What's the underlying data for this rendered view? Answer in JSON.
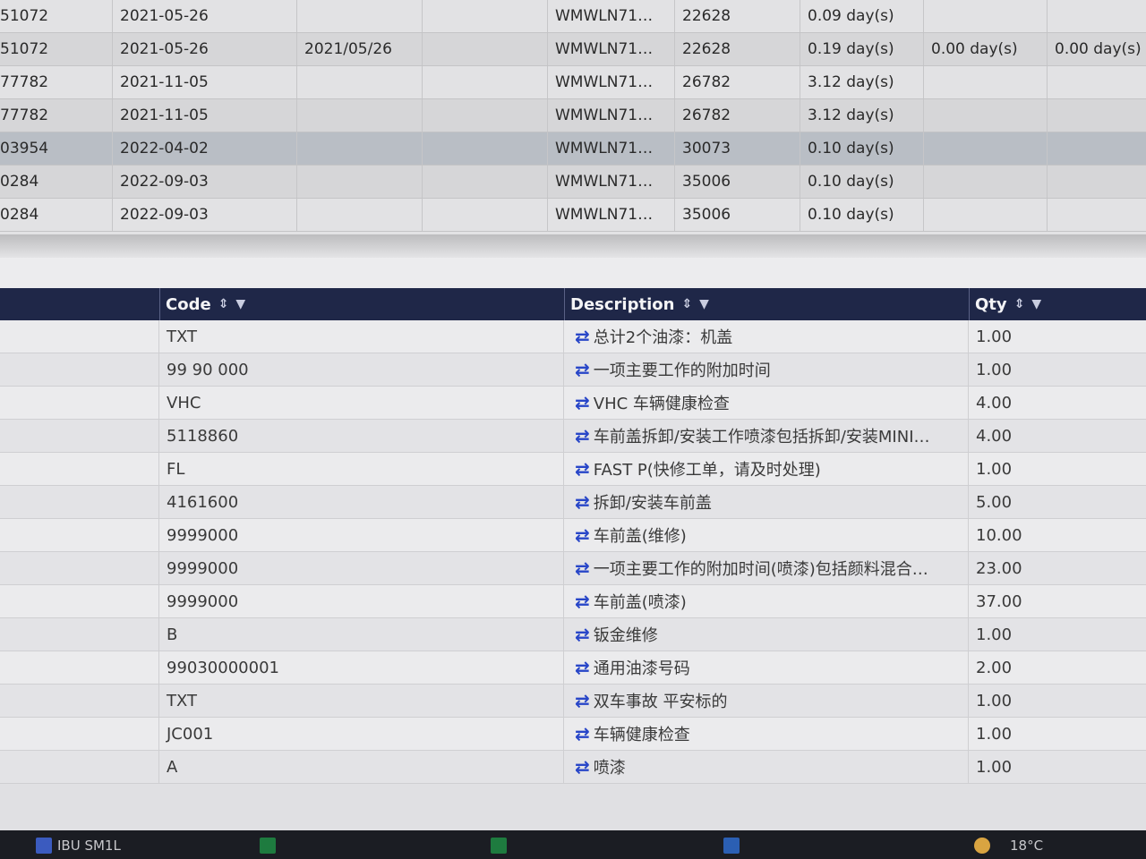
{
  "history": {
    "rows": [
      {
        "id": "51072",
        "date": "2021-05-26",
        "date2": "",
        "vin": "WMWLN71…",
        "km": "22628",
        "d1": "0.09 day(s)",
        "d2": "",
        "d3": ""
      },
      {
        "id": "51072",
        "date": "2021-05-26",
        "date2": "2021/05/26",
        "vin": "WMWLN71…",
        "km": "22628",
        "d1": "0.19 day(s)",
        "d2": "0.00 day(s)",
        "d3": "0.00 day(s)"
      },
      {
        "id": "77782",
        "date": "2021-11-05",
        "date2": "",
        "vin": "WMWLN71…",
        "km": "26782",
        "d1": "3.12 day(s)",
        "d2": "",
        "d3": ""
      },
      {
        "id": "77782",
        "date": "2021-11-05",
        "date2": "",
        "vin": "WMWLN71…",
        "km": "26782",
        "d1": "3.12 day(s)",
        "d2": "",
        "d3": ""
      },
      {
        "id": "03954",
        "date": "2022-04-02",
        "date2": "",
        "vin": "WMWLN71…",
        "km": "30073",
        "d1": "0.10 day(s)",
        "d2": "",
        "d3": ""
      },
      {
        "id": "0284",
        "date": "2022-09-03",
        "date2": "",
        "vin": "WMWLN71…",
        "km": "35006",
        "d1": "0.10 day(s)",
        "d2": "",
        "d3": ""
      },
      {
        "id": "0284",
        "date": "2022-09-03",
        "date2": "",
        "vin": "WMWLN71…",
        "km": "35006",
        "d1": "0.10 day(s)",
        "d2": "",
        "d3": ""
      }
    ]
  },
  "grid": {
    "headers": {
      "code": "Code",
      "description": "Description",
      "qty": "Qty"
    },
    "rows": [
      {
        "code": "TXT",
        "description": "总计2个油漆：机盖",
        "qty": "1.00"
      },
      {
        "code": "99 90 000",
        "description": "一项主要工作的附加时间",
        "qty": "1.00"
      },
      {
        "code": "VHC",
        "description": "VHC 车辆健康检查",
        "qty": "4.00"
      },
      {
        "code": "5118860",
        "description": "车前盖拆卸/安装工作喷漆包括拆卸/安装MINI…",
        "qty": "4.00"
      },
      {
        "code": "FL",
        "description": "FAST P(快修工单，请及时处理)",
        "qty": "1.00"
      },
      {
        "code": "4161600",
        "description": "拆卸/安装车前盖",
        "qty": "5.00"
      },
      {
        "code": "9999000",
        "description": "车前盖(维修)",
        "qty": "10.00"
      },
      {
        "code": "9999000",
        "description": "一项主要工作的附加时间(喷漆)包括颜料混合…",
        "qty": "23.00"
      },
      {
        "code": "9999000",
        "description": "车前盖(喷漆)",
        "qty": "37.00"
      },
      {
        "code": "B",
        "description": "钣金维修",
        "qty": "1.00"
      },
      {
        "code": "99030000001",
        "description": "通用油漆号码",
        "qty": "2.00"
      },
      {
        "code": "TXT",
        "description": "双车事故 平安标的",
        "qty": "1.00"
      },
      {
        "code": "JC001",
        "description": "车辆健康检查",
        "qty": "1.00"
      },
      {
        "code": "A",
        "description": "喷漆",
        "qty": "1.00"
      }
    ]
  },
  "icons": {
    "row_action": "swap-arrows-icon",
    "sort": "sort-icon",
    "filter": "filter-icon"
  },
  "taskbar": {
    "item1": "IBU SM1L",
    "temperature": "18°C"
  },
  "colors": {
    "header_bg": "#1f2748",
    "action_icon": "#2846c8",
    "selected_row": "#b9bec5"
  }
}
